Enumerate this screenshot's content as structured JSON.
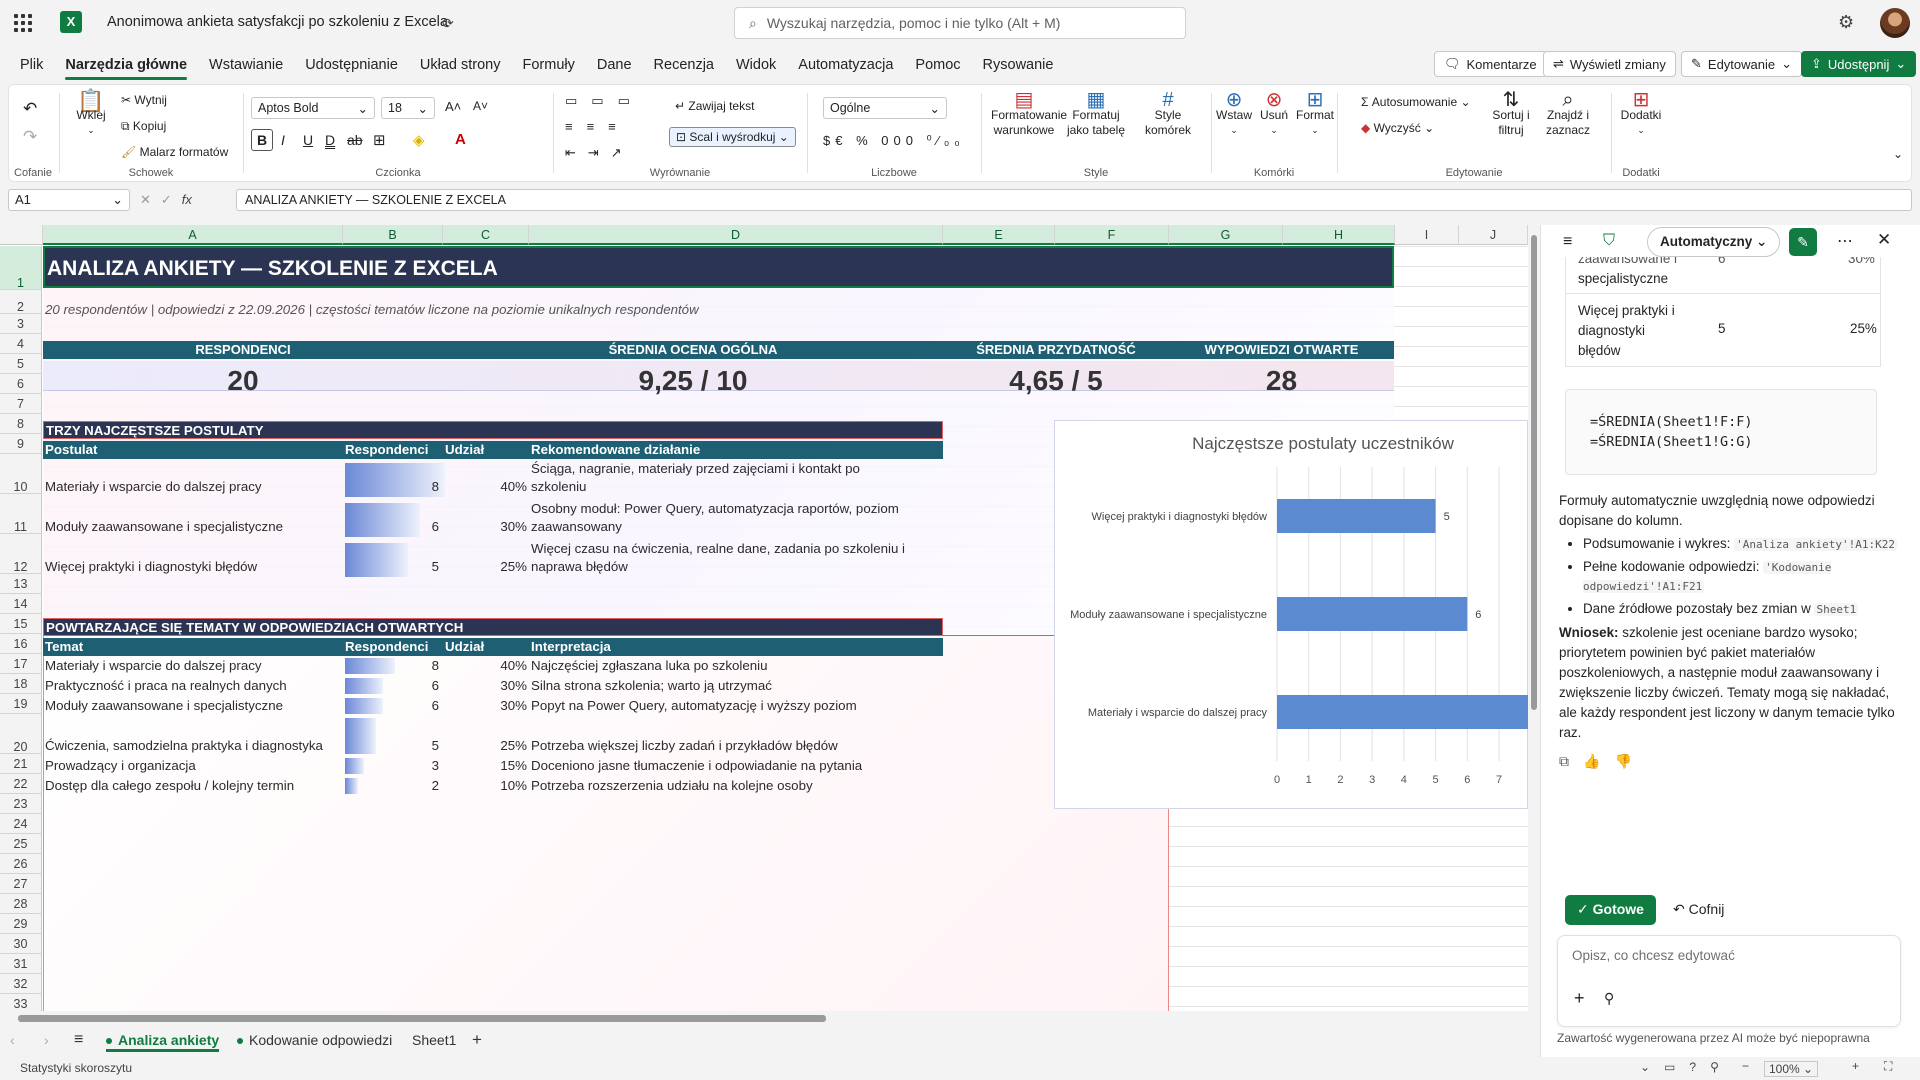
{
  "app": {
    "doc_title": "Anonimowa ankieta satysfakcji po szkoleniu z Excela",
    "search_placeholder": "Wyszukaj narzędzia, pomoc i nie tylko (Alt + M)"
  },
  "menu": [
    "Plik",
    "Narzędzia główne",
    "Wstawianie",
    "Udostępnianie",
    "Układ strony",
    "Formuły",
    "Dane",
    "Recenzja",
    "Widok",
    "Automatyzacja",
    "Pomoc",
    "Rysowanie"
  ],
  "top_buttons": {
    "comments": "Komentarze",
    "changes": "Wyświetl zmiany",
    "editing": "Edytowanie",
    "share": "Udostępnij"
  },
  "ribbon": {
    "undo_group": "Cofanie",
    "clipboard": {
      "paste": "Wklej",
      "cut": "Wytnij",
      "copy": "Kopiuj",
      "painter": "Malarz formatów",
      "label": "Schowek"
    },
    "font": {
      "name": "Aptos Bold",
      "size": "18",
      "label": "Czcionka"
    },
    "align": {
      "wrap": "Zawijaj tekst",
      "merge": "Scal i wyśrodkuj",
      "label": "Wyrównanie"
    },
    "number": {
      "format": "Ogólne",
      "label": "Liczbowe"
    },
    "styles": {
      "cond": "Formatowanie warunkowe",
      "table": "Formatuj jako tabelę",
      "cell": "Style komórek",
      "label": "Style"
    },
    "cells": {
      "insert": "Wstaw",
      "delete": "Usuń",
      "format": "Format",
      "label": "Komórki"
    },
    "editing": {
      "autosum": "Autosumowanie",
      "clear": "Wyczyść",
      "sort": "Sortuj i filtruj",
      "find": "Znajdź i zaznacz",
      "label": "Edytowanie"
    },
    "addins": {
      "btn": "Dodatki",
      "label": "Dodatki"
    }
  },
  "formula_bar": {
    "cell_ref": "A1",
    "fx": "fx",
    "content": "ANALIZA ANKIETY — SZKOLENIE Z EXCELA"
  },
  "columns": [
    "A",
    "B",
    "C",
    "D",
    "E",
    "F",
    "G",
    "H",
    "I",
    "J"
  ],
  "rows": [
    "1",
    "2",
    "3",
    "4",
    "5",
    "6",
    "7",
    "8",
    "9",
    "10",
    "11",
    "12",
    "13",
    "14",
    "15",
    "16",
    "17",
    "18",
    "19",
    "20",
    "21",
    "22",
    "23",
    "24",
    "25",
    "26",
    "27",
    "28",
    "29",
    "30",
    "31",
    "32",
    "33"
  ],
  "sheet": {
    "title": "ANALIZA ANKIETY — SZKOLENIE Z EXCELA",
    "subtitle": "20 respondentów | odpowiedzi z 22.09.2026 | częstości tematów liczone na poziomie unikalnych respondentów",
    "kpis": [
      {
        "label": "RESPONDENCI",
        "value": "20"
      },
      {
        "label": "ŚREDNIA OCENA OGÓLNA",
        "value": "9,25 / 10"
      },
      {
        "label": "ŚREDNIA PRZYDATNOŚĆ",
        "value": "4,65 / 5"
      },
      {
        "label": "WYPOWIEDZI OTWARTE",
        "value": "28"
      }
    ],
    "top3_title": "TRZY NAJCZĘSTSZE POSTULATY",
    "top3_headers": [
      "Postulat",
      "Respondenci",
      "Udział",
      "Rekomendowane działanie"
    ],
    "top3": [
      {
        "name": "Materiały i wsparcie do dalszej pracy",
        "n": "8",
        "share": "40%",
        "frac": 0.4,
        "action1": "Ściąga, nagranie, materiały przed zajęciami i kontakt po",
        "action2": "szkoleniu"
      },
      {
        "name": "Moduły zaawansowane i specjalistyczne",
        "n": "6",
        "share": "30%",
        "frac": 0.3,
        "action1": "Osobny moduł: Power Query, automatyzacja raportów, poziom",
        "action2": "zaawansowany"
      },
      {
        "name": "Więcej praktyki i diagnostyki błędów",
        "n": "5",
        "share": "25%",
        "frac": 0.25,
        "action1": "Więcej czasu na ćwiczenia, realne dane, zadania po szkoleniu i",
        "action2": "naprawa błędów"
      }
    ],
    "themes_title": "POWTARZAJĄCE SIĘ TEMATY W ODPOWIEDZIACH OTWARTYCH",
    "themes_headers": [
      "Temat",
      "Respondenci",
      "Udział",
      "Interpretacja"
    ],
    "themes": [
      {
        "name": "Materiały i wsparcie do dalszej pracy",
        "n": "8",
        "share": "40%",
        "frac": 0.4,
        "note": "Najczęściej zgłaszana luka po szkoleniu"
      },
      {
        "name": "Praktyczność i praca na realnych danych",
        "n": "6",
        "share": "30%",
        "frac": 0.3,
        "note": "Silna strona szkolenia; warto ją utrzymać"
      },
      {
        "name": "Moduły zaawansowane i specjalistyczne",
        "n": "6",
        "share": "30%",
        "frac": 0.3,
        "note": "Popyt na Power Query, automatyzację i wyższy poziom"
      },
      {
        "name": "Ćwiczenia, samodzielna praktyka i diagnostyka",
        "n": "5",
        "share": "25%",
        "frac": 0.25,
        "note": "Potrzeba większej liczby zadań i przykładów błędów"
      },
      {
        "name": "Prowadzący i organizacja",
        "n": "3",
        "share": "15%",
        "frac": 0.15,
        "note": "Doceniono jasne tłumaczenie i odpowiadanie na pytania"
      },
      {
        "name": "Dostęp dla całego zespołu / kolejny termin",
        "n": "2",
        "share": "10%",
        "frac": 0.1,
        "note": "Potrzeba rozszerzenia udziału na kolejne osoby"
      }
    ]
  },
  "chart_data": {
    "type": "bar",
    "orientation": "horizontal",
    "title": "Najczęstsze postulaty uczestników",
    "categories": [
      "Więcej praktyki i diagnostyki błędów",
      "Moduły zaawansowane i specjalistyczne",
      "Materiały i wsparcie do dalszej pracy"
    ],
    "values": [
      5,
      6,
      8
    ],
    "data_labels": [
      "5",
      "6",
      ""
    ],
    "xlim": [
      0,
      7
    ],
    "xticks": [
      "0",
      "1",
      "2",
      "3",
      "4",
      "5",
      "6",
      "7"
    ],
    "grid": true,
    "bar_color": "#5b8ad0"
  },
  "sheet_tabs": [
    "Analiza ankiety",
    "Kodowanie odpowiedzi",
    "Sheet1"
  ],
  "status": {
    "left": "Statystyki skoroszytu",
    "zoom": "100%"
  },
  "copilot": {
    "mode": "Automatyczny",
    "table_partial": [
      {
        "name1": "zaawansowane i",
        "name2": "specjalistyczne",
        "n": "6",
        "share": "30%"
      },
      {
        "name1": "Więcej praktyki i",
        "name2": "diagnostyki",
        "name3": "błędów",
        "n": "5",
        "share": "25%"
      }
    ],
    "code1": "=ŚREDNIA(Sheet1!F:F)",
    "code2": "=ŚREDNIA(Sheet1!G:G)",
    "para1": "Formuły automatycznie uwzględnią nowe odpowiedzi dopisane do kolumn.",
    "bullets": [
      {
        "text": "Podsumowanie i wykres: ",
        "code": "'Analiza ankiety'!A1:K22"
      },
      {
        "text": "Pełne kodowanie odpowiedzi: ",
        "code": "'Kodowanie odpowiedzi'!A1:F21"
      },
      {
        "text": "Dane źródłowe pozostały bez zmian w ",
        "code": "Sheet1"
      }
    ],
    "conclusion_label": "Wniosek:",
    "conclusion": " szkolenie jest oceniane bardzo wysoko; priorytetem powinien być pakiet materiałów poszkoleniowych, a następnie moduł zaawansowany i zwiększenie liczby ćwiczeń. Tematy mogą się nakładać, ale każdy respondent jest liczony w danym temacie tylko raz.",
    "done": "Gotowe",
    "undo": "Cofnij",
    "prompt_placeholder": "Opisz, co chcesz edytować",
    "disclaimer": "Zawartość wygenerowana przez AI może być niepoprawna"
  }
}
